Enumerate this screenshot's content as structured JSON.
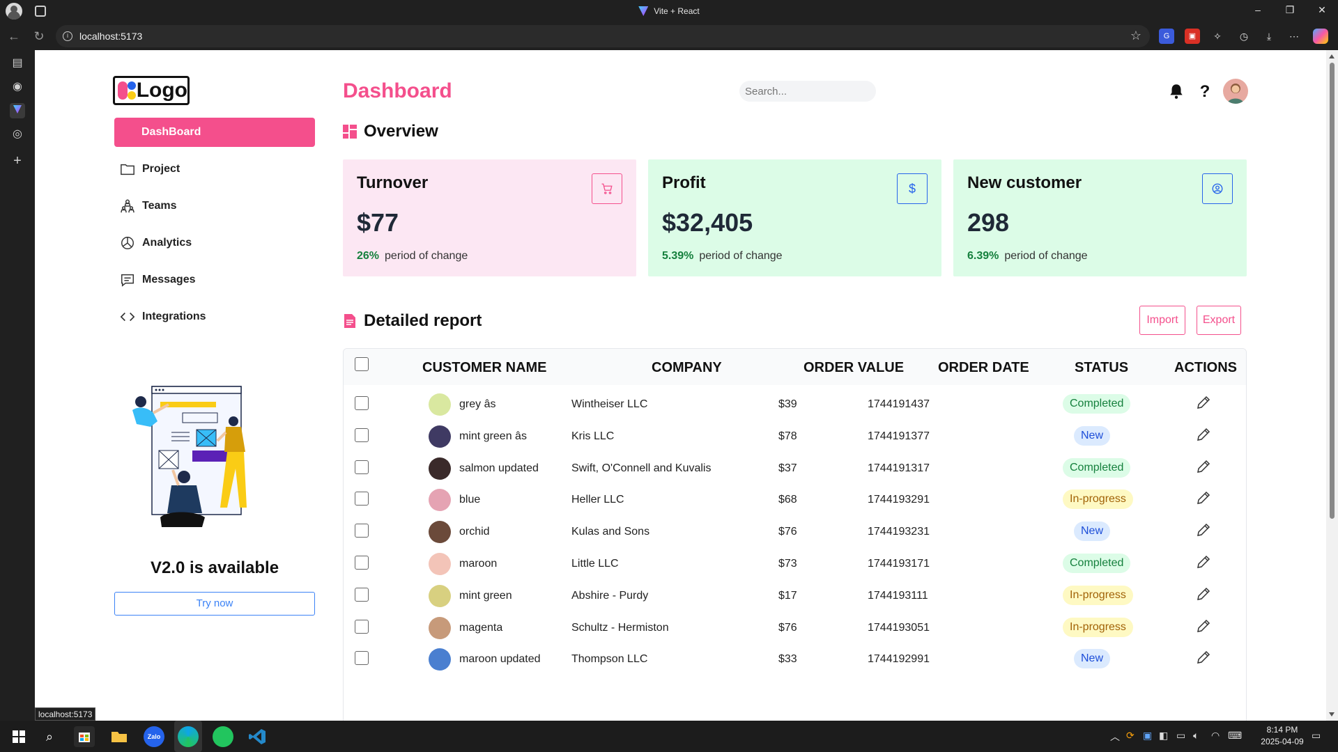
{
  "browser": {
    "tab_title": "Vite + React",
    "url": "localhost:5173",
    "status_tooltip": "localhost:5173"
  },
  "sidebar": {
    "logo_text": "Logo",
    "items": [
      {
        "label": "DashBoard",
        "icon": "none",
        "active": true
      },
      {
        "label": "Project",
        "icon": "folder-icon"
      },
      {
        "label": "Teams",
        "icon": "teams-icon"
      },
      {
        "label": "Analytics",
        "icon": "pie-chart-icon"
      },
      {
        "label": "Messages",
        "icon": "message-icon"
      },
      {
        "label": "Integrations",
        "icon": "code-icon"
      }
    ],
    "promo_title": "V2.0 is available",
    "promo_button": "Try now"
  },
  "header": {
    "title": "Dashboard",
    "search_placeholder": "Search..."
  },
  "overview": {
    "title": "Overview",
    "cards": [
      {
        "title": "Turnover",
        "value": "$77",
        "change": "26%",
        "change_label": "period of change",
        "icon": "cart-icon",
        "bg": "#fce7f3",
        "accent": "#f44f8c"
      },
      {
        "title": "Profit",
        "value": "$32,405",
        "change": "5.39%",
        "change_label": "period of change",
        "icon": "dollar-icon",
        "bg": "#dcfce7",
        "accent": "#2563eb"
      },
      {
        "title": "New customer",
        "value": "298",
        "change": "6.39%",
        "change_label": "period of change",
        "icon": "user-circle-icon",
        "bg": "#dcfce7",
        "accent": "#2563eb"
      }
    ]
  },
  "report": {
    "title": "Detailed report",
    "import_label": "Import",
    "export_label": "Export",
    "columns": [
      "CUSTOMER NAME",
      "COMPANY",
      "ORDER VALUE",
      "ORDER DATE",
      "STATUS",
      "ACTIONS"
    ],
    "rows": [
      {
        "name": "grey âs",
        "company": "Wintheiser LLC",
        "value": "$39",
        "date": "1744191437",
        "status": "Completed"
      },
      {
        "name": "mint green âs",
        "company": "Kris LLC",
        "value": "$78",
        "date": "1744191377",
        "status": "New"
      },
      {
        "name": "salmon updated",
        "company": "Swift, O'Connell and Kuvalis",
        "value": "$37",
        "date": "1744191317",
        "status": "Completed"
      },
      {
        "name": "blue",
        "company": "Heller LLC",
        "value": "$68",
        "date": "1744193291",
        "status": "In-progress"
      },
      {
        "name": "orchid",
        "company": "Kulas and Sons",
        "value": "$76",
        "date": "1744193231",
        "status": "New"
      },
      {
        "name": "maroon",
        "company": "Little LLC",
        "value": "$73",
        "date": "1744193171",
        "status": "Completed"
      },
      {
        "name": "mint green",
        "company": "Abshire - Purdy",
        "value": "$17",
        "date": "1744193111",
        "status": "In-progress"
      },
      {
        "name": "magenta",
        "company": "Schultz - Hermiston",
        "value": "$76",
        "date": "1744193051",
        "status": "In-progress"
      },
      {
        "name": "maroon updated",
        "company": "Thompson LLC",
        "value": "$33",
        "date": "1744192991",
        "status": "New"
      }
    ]
  },
  "taskbar": {
    "time": "8:14 PM",
    "date": "2025-04-09"
  }
}
